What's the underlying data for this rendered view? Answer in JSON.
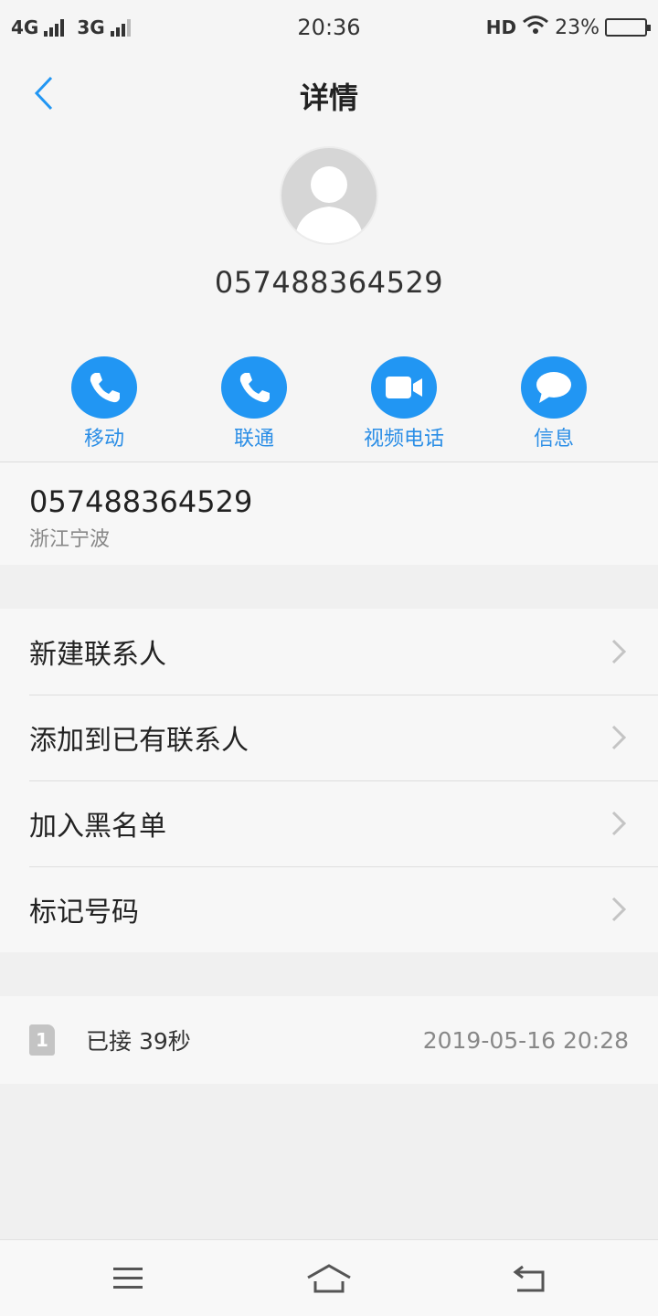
{
  "status_bar": {
    "network1": "4G",
    "network2": "3G",
    "time": "20:36",
    "hd": "HD",
    "battery_text": "23%",
    "battery_level": 0.23
  },
  "header": {
    "title": "详情"
  },
  "profile": {
    "number": "057488364529"
  },
  "actions": [
    {
      "label": "移动",
      "icon": "phone-icon"
    },
    {
      "label": "联通",
      "icon": "phone-icon"
    },
    {
      "label": "视频电话",
      "icon": "video-camera-icon"
    },
    {
      "label": "信息",
      "icon": "message-bubble-icon"
    }
  ],
  "number_info": {
    "number": "057488364529",
    "location": "浙江宁波"
  },
  "menu": [
    {
      "label": "新建联系人"
    },
    {
      "label": "添加到已有联系人"
    },
    {
      "label": "加入黑名单"
    },
    {
      "label": "标记号码"
    }
  ],
  "call_log": {
    "sim": "1",
    "status": "已接 39秒",
    "time": "2019-05-16 20:28"
  },
  "colors": {
    "accent": "#2196f3",
    "accent_text": "#2b8ee6",
    "background": "#f0f0f0"
  }
}
